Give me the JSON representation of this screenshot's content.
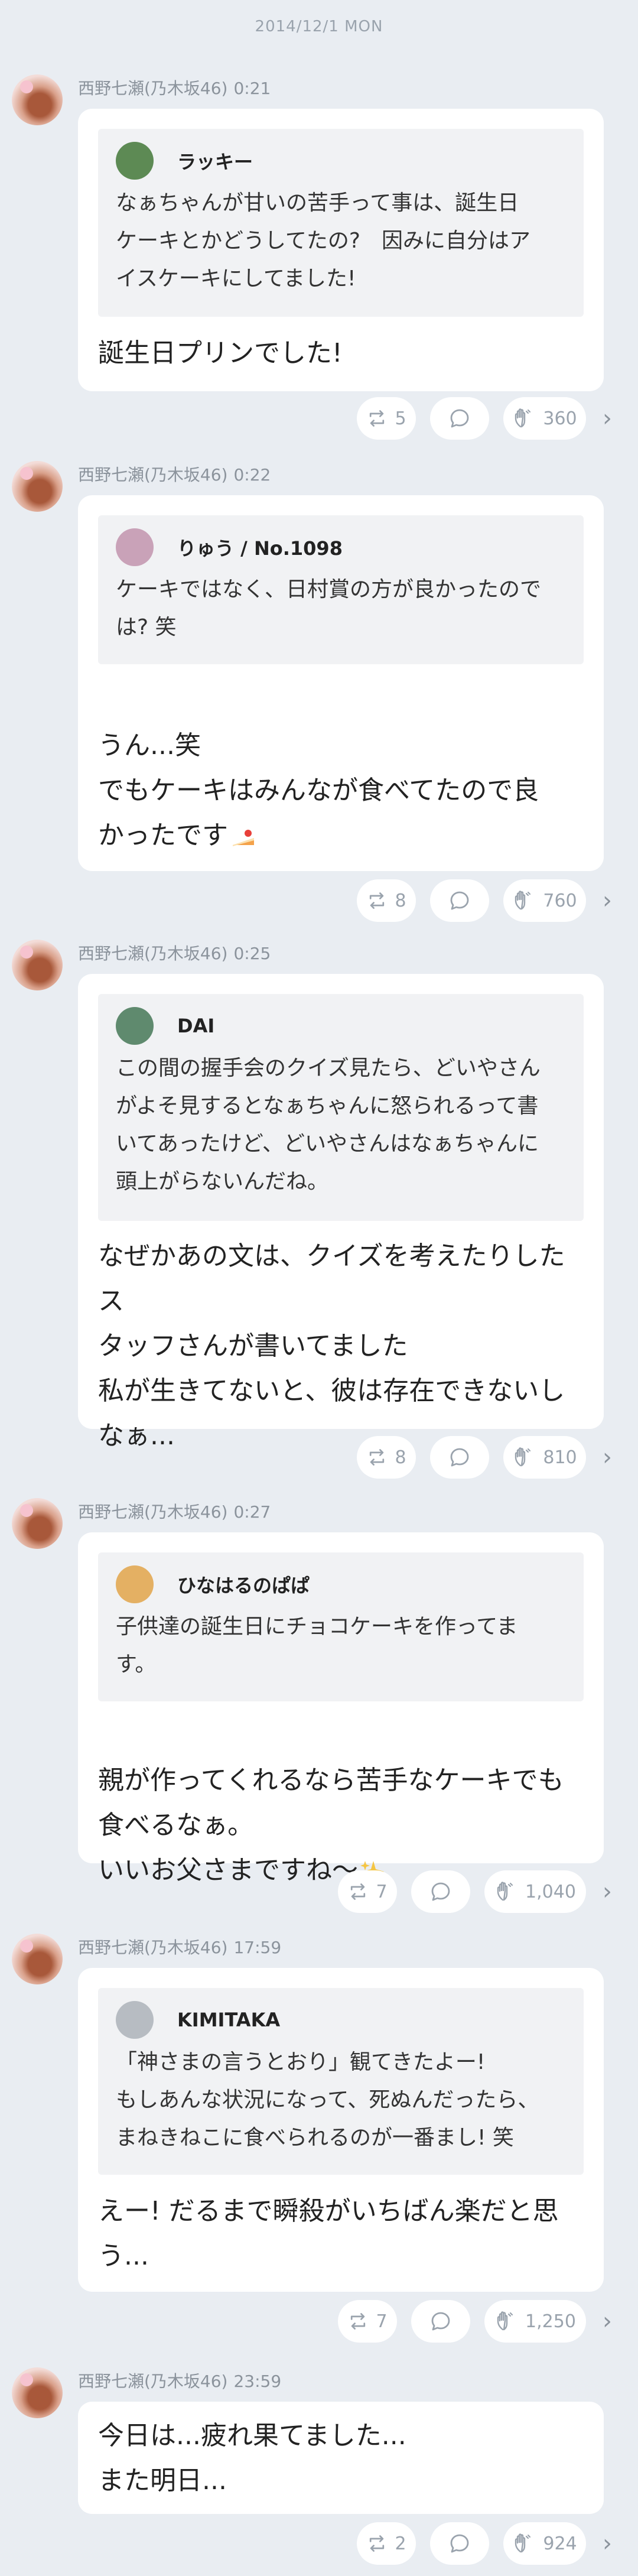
{
  "date": "2014/12/1 MON",
  "messages": [
    {
      "author": "西野七瀬(乃木坂46)",
      "time": "0:21",
      "quote_name": "ラッキー",
      "quote_text": "なぁちゃんが甘いの苦手って事は、誕生日\nケーキとかどうしてたの?　因みに自分はア\nイスケーキにしてました!",
      "body": "誕生日プリンでした!",
      "retweets": "5",
      "likes": "360"
    },
    {
      "author": "西野七瀬(乃木坂46)",
      "time": "0:22",
      "quote_name": "りゅう / No.1098",
      "quote_text": "ケーキではなく、日村賞の方が良かったので\nは? 笑",
      "body": "うん...笑\nでもケーキはみんなが食べてたので良\nかったです",
      "retweets": "8",
      "likes": "760"
    },
    {
      "author": "西野七瀬(乃木坂46)",
      "time": "0:25",
      "quote_name": "DAI",
      "quote_text": "この間の握手会のクイズ見たら、どいやさん\nがよそ見するとなぁちゃんに怒られるって書\nいてあったけど、どいやさんはなぁちゃんに\n頭上がらないんだね。",
      "body": "なぜかあの文は、クイズを考えたりしたス\nタッフさんが書いてました\n私が生きてないと、彼は存在できないし\nなぁ...",
      "retweets": "8",
      "likes": "810"
    },
    {
      "author": "西野七瀬(乃木坂46)",
      "time": "0:27",
      "quote_name": "ひなはるのぱぱ",
      "quote_text": "子供達の誕生日にチョコケーキを作ってま\nす。",
      "body": "親が作ってくれるなら苦手なケーキでも\n食べるなぁ。\nいいお父さまですね〜",
      "retweets": "7",
      "likes": "1,040"
    },
    {
      "author": "西野七瀬(乃木坂46)",
      "time": "17:59",
      "quote_name": "KIMITAKA",
      "quote_text": "「神さまの言うとおり」観てきたよー!\nもしあんな状況になって、死ぬんだったら、\nまねきねこに食べられるのが一番まし! 笑",
      "body": "えー! だるまで瞬殺がいちばん楽だと思\nう...",
      "retweets": "7",
      "likes": "1,250"
    },
    {
      "author": "西野七瀬(乃木坂46)",
      "time": "23:59",
      "body": "今日は...疲れ果てました...\nまた明日...",
      "retweets": "2",
      "likes": "924"
    }
  ]
}
